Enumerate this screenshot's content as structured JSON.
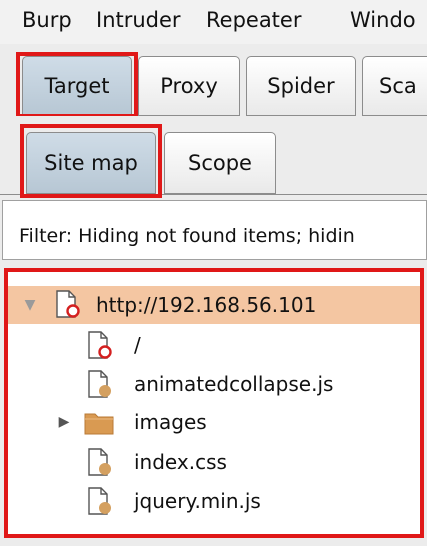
{
  "menubar": {
    "items": [
      "Burp",
      "Intruder",
      "Repeater",
      "Windo"
    ]
  },
  "main_tabs": [
    {
      "label": "Target",
      "selected": true
    },
    {
      "label": "Proxy",
      "selected": false
    },
    {
      "label": "Spider",
      "selected": false
    },
    {
      "label": "Sca",
      "selected": false
    }
  ],
  "sub_tabs": [
    {
      "label": "Site map",
      "selected": true
    },
    {
      "label": "Scope",
      "selected": false
    }
  ],
  "filter": {
    "text": "Filter: Hiding not found items;  hidin"
  },
  "site_tree": {
    "root": {
      "label": "http://192.168.56.101",
      "expanded": true,
      "icon": "host-icon"
    },
    "children": [
      {
        "label": "/",
        "icon": "file-red-icon"
      },
      {
        "label": "animatedcollapse.js",
        "icon": "file-icon"
      },
      {
        "label": "images",
        "icon": "folder-icon",
        "collapsed": true
      },
      {
        "label": "index.css",
        "icon": "file-icon"
      },
      {
        "label": "jquery.min.js",
        "icon": "file-icon"
      }
    ]
  },
  "colors": {
    "highlight": "#e01818",
    "selected_row": "#f4c6a2",
    "selected_tab": "#b7c7d4",
    "file_dot": "#d4a060",
    "folder": "#d99a52"
  }
}
